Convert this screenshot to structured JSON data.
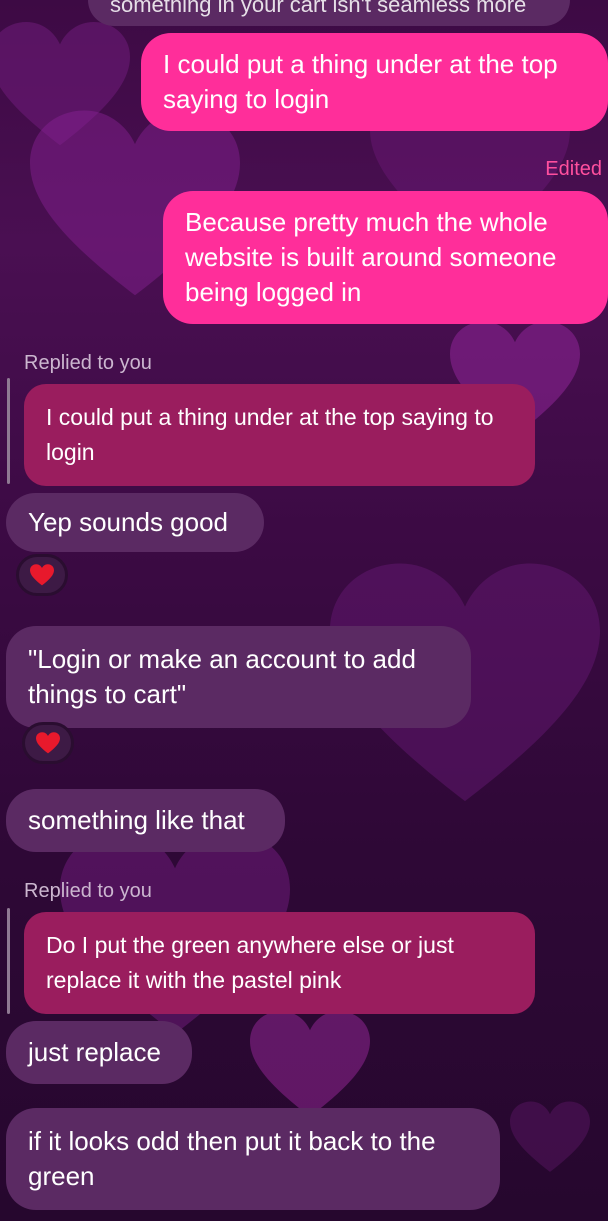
{
  "messages": {
    "top_cutoff": "something in your cart isn't seamless more",
    "m1": "I could put a thing under at the top saying to login",
    "edited_label": "Edited",
    "m2": "Because pretty much the whole website is built around someone being logged in",
    "replied_label_1": "Replied to you",
    "quote_1": "I could put a thing under at the top saying to login",
    "m3": "Yep sounds good",
    "m4": "\"Login or make an account to add things to cart\"",
    "m5": "something like that",
    "replied_label_2": "Replied to you",
    "quote_2": "Do I put the green anywhere else or just replace it with the pastel pink",
    "m6": "just replace",
    "m7": "if it looks odd then put it back to the green"
  },
  "reactions": {
    "r1": "heart-reaction",
    "r2": "heart-reaction"
  },
  "colors": {
    "outgoing_bubble": "#ff2e9a",
    "incoming_bubble": "#5b2a63",
    "quote_bubble": "#9a1d5e",
    "edited_text": "#ff4f9e",
    "heart": "#e8192c"
  }
}
